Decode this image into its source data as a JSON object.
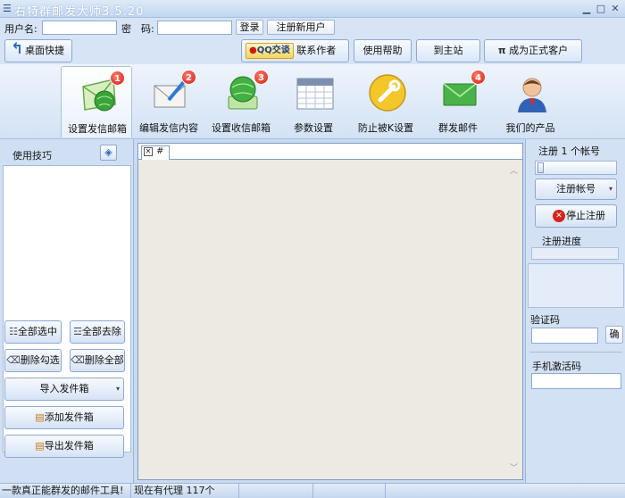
{
  "window": {
    "title": "右特群邮发大师3.5.20",
    "controls": [
      "minimize-icon",
      "maximize-icon",
      "close-icon"
    ]
  },
  "login": {
    "username_label": "用户名:",
    "username_value": "",
    "password_label": "密　码:",
    "password_value": "",
    "login_button": "登录",
    "register_button": "注册新用户"
  },
  "toolbar": {
    "desktop_shortcut": "桌面快捷",
    "qq_badge": "QQ交谈",
    "contact_author": "联系作者",
    "help": "使用帮助",
    "main_site": "到主站",
    "pi_symbol": "π",
    "become_customer": "成为正式客户"
  },
  "ribbon": {
    "tabs": [
      {
        "label": "设置发信邮箱",
        "icon": "envelope-globe-icon",
        "badge": "1",
        "active": true
      },
      {
        "label": "编辑发信内容",
        "icon": "envelope-edit-icon",
        "badge": "2",
        "active": false
      },
      {
        "label": "设置收信邮箱",
        "icon": "globe-inbox-icon",
        "badge": "3",
        "active": false
      },
      {
        "label": "参数设置",
        "icon": "calendar-settings-icon",
        "badge": "",
        "active": false
      },
      {
        "label": "防止被K设置",
        "icon": "wrench-icon",
        "badge": "",
        "active": false
      },
      {
        "label": "群发邮件",
        "icon": "green-envelope-icon",
        "badge": "4",
        "active": false
      },
      {
        "label": "我们的产品",
        "icon": "user-avatar-icon",
        "badge": "",
        "active": false
      }
    ]
  },
  "left_panel": {
    "title": "使用技巧",
    "select_all": "全部选中",
    "deselect_all": "全部去除",
    "delete_checked": "删除勾选",
    "delete_all": "删除全部",
    "import_outbox": "导入发件箱",
    "add_outbox": "添加发件箱",
    "export_outbox": "导出发件箱"
  },
  "center": {
    "tab_label": "#"
  },
  "right_panel": {
    "register_count": "注册 1 个帐号",
    "register_account": "注册帐号",
    "stop_register": "停止注册",
    "progress_label": "注册进度",
    "progress": 0,
    "captcha_label": "验证码",
    "captcha_value": "",
    "confirm_button": "确",
    "phone_code_label": "手机激活码",
    "phone_code_value": ""
  },
  "statusbar": {
    "slogan": "一款真正能群发的邮件工具!",
    "proxy_status": "现在有代理 117个"
  },
  "colors": {
    "window_bg": "#c9daf0",
    "badge_red": "#d11a10",
    "stop_red": "#d8231b",
    "document_bg": "#eceae3"
  }
}
